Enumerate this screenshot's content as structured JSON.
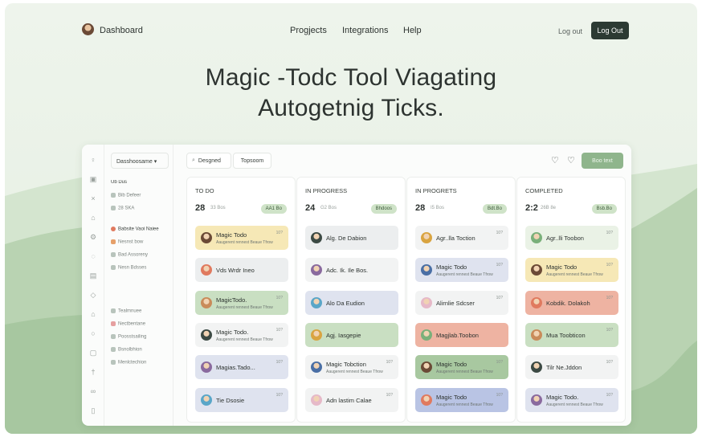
{
  "nav": {
    "brand": "Dashboard",
    "links": [
      "Progjects",
      "Integrations",
      "Help"
    ],
    "logout_link": "Log out",
    "logout_button": "Log Out"
  },
  "hero": {
    "line1": "Magic -Todc Tool Viagating",
    "line2": "Autogetnig Ticks."
  },
  "app": {
    "workspace_select": "Dasshoosame ▾",
    "sidebar": [
      "Ub Dus",
      "Bib Defeer",
      "28 SKA",
      "Babsite Vaoi Naiee",
      "Nesnst bow",
      "Bad Assoreny",
      "Nesn Bdsses",
      "Tealmnuee",
      "Nectbentane",
      "Poosstsailing",
      "Bsnolbhion",
      "Menlctechion"
    ],
    "search_placeholder": "Desgned",
    "filter_tab": "Topsoom",
    "new_button": "Boo text",
    "columns": [
      {
        "title": "TO DO",
        "count": "28",
        "sub": "33 Bos",
        "pill": "AA1 Bo",
        "cards": [
          {
            "title": "Magic Todo",
            "subtitle": "Aaugerent rennest Beaue Tfrow",
            "meta": "10?"
          },
          {
            "title": "Vds Wrdr Ineo",
            "subtitle": "",
            "meta": ""
          },
          {
            "title": "MagicTodo.",
            "subtitle": "Aaugerent rennest Beaue Tfrow",
            "meta": "10?"
          },
          {
            "title": "Magic Todo.",
            "subtitle": "Aaugerent rennest Beaue Tfrow",
            "meta": "10?"
          },
          {
            "title": "Magias.Tado...",
            "subtitle": "",
            "meta": "10?"
          },
          {
            "title": "Tie Dsosie",
            "subtitle": "",
            "meta": "10?"
          }
        ]
      },
      {
        "title": "IN PROGRESS",
        "count": "24",
        "sub": "G2 Bos",
        "pill": "Bhdoos",
        "cards": [
          {
            "title": "Alg. De Dabion",
            "subtitle": "",
            "meta": ""
          },
          {
            "title": "Adc. Ik. Ile Bos.",
            "subtitle": "",
            "meta": ""
          },
          {
            "title": "Alo Da Eudion",
            "subtitle": "",
            "meta": ""
          },
          {
            "title": "Agj. Iasgepie",
            "subtitle": "",
            "meta": ""
          },
          {
            "title": "Magic Tobction",
            "subtitle": "Aaugerent rennest Beaue Tfrow",
            "meta": "10?"
          },
          {
            "title": "Adn lastim Calae",
            "subtitle": "",
            "meta": "10?"
          }
        ]
      },
      {
        "title": "IN PROGRETS",
        "count": "28",
        "sub": "I5 Bos",
        "pill": "Bdt.Bo",
        "cards": [
          {
            "title": "Agr..lla Toction",
            "subtitle": "",
            "meta": "10?"
          },
          {
            "title": "Magic Todo",
            "subtitle": "Aaugerent rennest Beaue Tfrow",
            "meta": "10?"
          },
          {
            "title": "Alirnlie Sdcser",
            "subtitle": "",
            "meta": "10?"
          },
          {
            "title": "Magjlab.Toobon",
            "subtitle": "",
            "meta": ""
          },
          {
            "title": "Magic Todo",
            "subtitle": "Aaugerent rennest Beaue Tfrow",
            "meta": "10?"
          },
          {
            "title": "Magic Todo",
            "subtitle": "Aaugerent rennest Beaue Tfrow",
            "meta": "10?"
          }
        ]
      },
      {
        "title": "COMPLETED",
        "count": "2:2",
        "sub": "26B 8e",
        "pill": "Bsb.Bo",
        "cards": [
          {
            "title": "Agr..lli Toobon",
            "subtitle": "",
            "meta": "10?"
          },
          {
            "title": "Magic Todo",
            "subtitle": "Aaugerent rennest Beaue Tfrow",
            "meta": "10?"
          },
          {
            "title": "Kobdik. Dolakoh",
            "subtitle": "",
            "meta": "10?"
          },
          {
            "title": "Mua Toobticon",
            "subtitle": "",
            "meta": "10?"
          },
          {
            "title": "Tilr Ne.Jddon",
            "subtitle": "",
            "meta": "10?"
          },
          {
            "title": "Magic Todo.",
            "subtitle": "Aaugerent rennest Beaue Tfrow",
            "meta": "10?"
          }
        ]
      }
    ]
  },
  "colors": {
    "accent": "#8fb58c",
    "dark_button": "#2c3a33",
    "card_yellow": "#f6e8b6",
    "card_green": "#c9dfc2",
    "card_gray": "#eceeef",
    "card_blue": "#dfe3ef",
    "card_salmon": "#eeb3a2",
    "card_lavender": "#b9c4e4"
  }
}
